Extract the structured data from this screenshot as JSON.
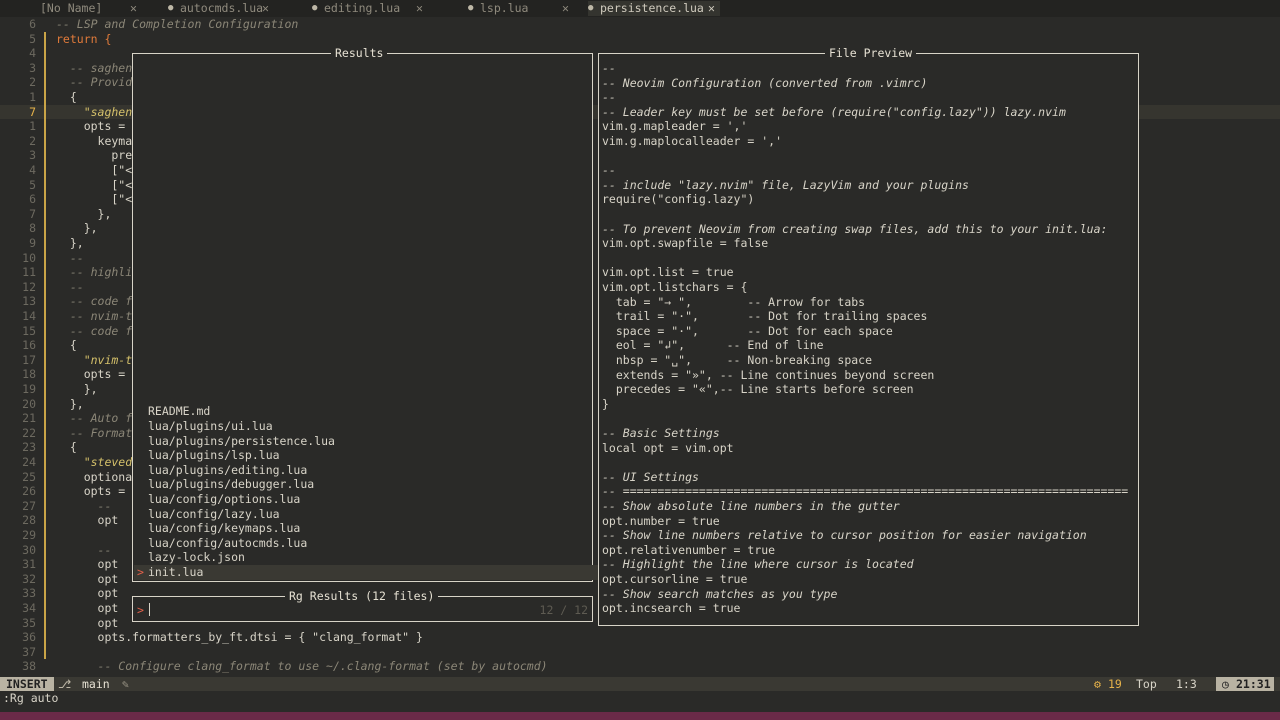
{
  "tabs": [
    {
      "label": "[No Name]",
      "close": "✕"
    },
    {
      "label": "autocmds.lua",
      "close": "✕"
    },
    {
      "label": "editing.lua",
      "close": "✕"
    },
    {
      "label": "lsp.lua",
      "close": "✕"
    },
    {
      "label": "persistence.lua",
      "close": "✕"
    }
  ],
  "editor_lines": [
    {
      "n": "6",
      "code": "-- LSP and Completion Configuration"
    },
    {
      "n": "5",
      "code": "return {"
    },
    {
      "n": "4",
      "code": ""
    },
    {
      "n": "3",
      "code": "  -- saghen"
    },
    {
      "n": "2",
      "code": "  -- Provid"
    },
    {
      "n": "1",
      "code": "  {"
    },
    {
      "n": "7",
      "code": "    \"saghen"
    },
    {
      "n": "1",
      "code": "    opts ="
    },
    {
      "n": "2",
      "code": "      keyma"
    },
    {
      "n": "3",
      "code": "        pre"
    },
    {
      "n": "4",
      "code": "        [\"<"
    },
    {
      "n": "5",
      "code": "        [\"<"
    },
    {
      "n": "6",
      "code": "        [\"<"
    },
    {
      "n": "7",
      "code": "      },"
    },
    {
      "n": "8",
      "code": "    },"
    },
    {
      "n": "9",
      "code": "  },"
    },
    {
      "n": "10",
      "code": "  --"
    },
    {
      "n": "11",
      "code": "  -- highli"
    },
    {
      "n": "12",
      "code": "  --"
    },
    {
      "n": "13",
      "code": "  -- code f"
    },
    {
      "n": "14",
      "code": "  -- nvim-t"
    },
    {
      "n": "15",
      "code": "  -- code f"
    },
    {
      "n": "16",
      "code": "  {"
    },
    {
      "n": "17",
      "code": "    \"nvim-t"
    },
    {
      "n": "18",
      "code": "    opts ="
    },
    {
      "n": "19",
      "code": "    },"
    },
    {
      "n": "20",
      "code": "  },"
    },
    {
      "n": "21",
      "code": "  -- Auto for"
    },
    {
      "n": "22",
      "code": "  -- Formatti"
    },
    {
      "n": "23",
      "code": "  {"
    },
    {
      "n": "24",
      "code": "    \"steved"
    },
    {
      "n": "25",
      "code": "    optiona"
    },
    {
      "n": "26",
      "code": "    opts ="
    },
    {
      "n": "27",
      "code": "      --"
    },
    {
      "n": "28",
      "code": "      opt"
    },
    {
      "n": "29",
      "code": ""
    },
    {
      "n": "30",
      "code": "      --"
    },
    {
      "n": "31",
      "code": "      opt"
    },
    {
      "n": "32",
      "code": "      opt"
    },
    {
      "n": "33",
      "code": "      opt"
    },
    {
      "n": "34",
      "code": "      opt"
    },
    {
      "n": "35",
      "code": "      opt"
    },
    {
      "n": "36",
      "code": "      opts.formatters_by_ft.dtsi = { \"clang_format\" }"
    },
    {
      "n": "37",
      "code": ""
    },
    {
      "n": "38",
      "code": "      -- Configure clang_format to use ~/.clang-format (set by autocmd)"
    }
  ],
  "results": {
    "title": "Results",
    "items": [
      "README.md",
      "lua/plugins/ui.lua",
      "lua/plugins/persistence.lua",
      "lua/plugins/lsp.lua",
      "lua/plugins/editing.lua",
      "lua/plugins/debugger.lua",
      "lua/config/options.lua",
      "lua/config/lazy.lua",
      "lua/config/keymaps.lua",
      "lua/config/autocmds.lua",
      "lazy-lock.json",
      "init.lua"
    ],
    "selected_marker": ">"
  },
  "prompt": {
    "title": "Rg Results (12 files)",
    "prefix": ">",
    "value": "",
    "counter": "12 / 12"
  },
  "preview": {
    "title": "File Preview",
    "lines": [
      {
        "t": "--",
        "s": "cmt"
      },
      {
        "t": "-- Neovim Configuration (converted from .vimrc)",
        "s": "cmt"
      },
      {
        "t": "--",
        "s": "cmt"
      },
      {
        "t": "-- Leader key must be set before (require(\"config.lazy\")) lazy.nvim",
        "s": "cmt"
      },
      {
        "t": "vim.g.mapleader = ','",
        "s": "code"
      },
      {
        "t": "vim.g.maplocalleader = ','",
        "s": "code"
      },
      {
        "t": "",
        "s": "code"
      },
      {
        "t": "--",
        "s": "cmt"
      },
      {
        "t": "-- include \"lazy.nvim\" file, LazyVim and your plugins",
        "s": "cmt"
      },
      {
        "t": "require(\"config.lazy\")",
        "s": "req"
      },
      {
        "t": "",
        "s": "code"
      },
      {
        "t": "-- To prevent Neovim from creating swap files, add this to your init.lua:",
        "s": "cmt"
      },
      {
        "t": "vim.opt.swapfile = false",
        "s": "code"
      },
      {
        "t": "",
        "s": "code"
      },
      {
        "t": "vim.opt.list = true",
        "s": "code"
      },
      {
        "t": "vim.opt.listchars = {",
        "s": "code"
      },
      {
        "t": "  tab = \"→ \",        -- Arrow for tabs",
        "s": "code"
      },
      {
        "t": "  trail = \"·\",       -- Dot for trailing spaces",
        "s": "code"
      },
      {
        "t": "  space = \"·\",       -- Dot for each space",
        "s": "code"
      },
      {
        "t": "  eol = \"↲\",      -- End of line",
        "s": "code"
      },
      {
        "t": "  nbsp = \"␣\",     -- Non-breaking space",
        "s": "code"
      },
      {
        "t": "  extends = \"»\", -- Line continues beyond screen",
        "s": "code"
      },
      {
        "t": "  precedes = \"«\",-- Line starts before screen",
        "s": "code"
      },
      {
        "t": "}",
        "s": "code"
      },
      {
        "t": "",
        "s": "code"
      },
      {
        "t": "-- Basic Settings",
        "s": "cmt"
      },
      {
        "t": "local opt = vim.opt",
        "s": "local"
      },
      {
        "t": "",
        "s": "code"
      },
      {
        "t": "-- UI Settings",
        "s": "cmt"
      },
      {
        "t": "-- =========================================================================",
        "s": "cmt"
      },
      {
        "t": "-- Show absolute line numbers in the gutter",
        "s": "cmt"
      },
      {
        "t": "opt.number = true",
        "s": "code"
      },
      {
        "t": "-- Show line numbers relative to cursor position for easier navigation",
        "s": "cmt"
      },
      {
        "t": "opt.relativenumber = true",
        "s": "code"
      },
      {
        "t": "-- Highlight the line where cursor is located",
        "s": "cmt"
      },
      {
        "t": "opt.cursorline = true",
        "s": "code"
      },
      {
        "t": "-- Show search matches as you type",
        "s": "cmt"
      },
      {
        "t": "opt.incsearch = true",
        "s": "code"
      }
    ]
  },
  "statusline": {
    "mode": "INSERT",
    "branch": "main",
    "branch_icon": "git-branch-icon",
    "diagnostics": "19",
    "position": "Top",
    "cursor": "1:3",
    "time": "21:31"
  },
  "cmdline": ":Rg auto",
  "colors": {
    "accent": "#e6b24a",
    "background": "#2a2a28",
    "mode_bg": "#b9b3a3",
    "border": "#d8d4c8",
    "bottom_strip": "#6a2a48"
  }
}
